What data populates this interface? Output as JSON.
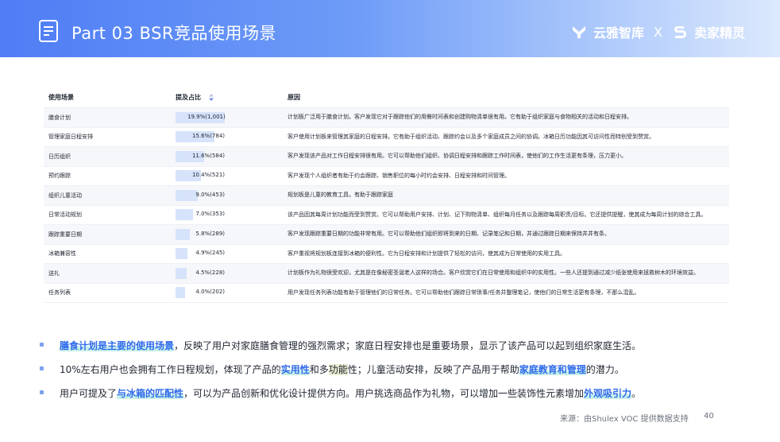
{
  "header": {
    "title": "Part 03  BSR竞品使用场景",
    "brand_left": "云雅智库",
    "brand_x": "X",
    "brand_right": "卖家精灵"
  },
  "table": {
    "columns": [
      "使用场景",
      "提及占比",
      "原因"
    ],
    "rows": [
      {
        "scene": "膳食计划",
        "share": 0.199,
        "pct": "19.9%(1,001)",
        "reason": "计划板广泛用于膳食计划。客户发现它对于跟踪他们的用餐时间表和创建购物清单很有用。它有助于组织家庭与食物相关的活动和日程安排。"
      },
      {
        "scene": "管理家庭日程安排",
        "share": 0.156,
        "pct": "15.6%(784)",
        "reason": "客户使用计划板来管理其家庭的日程安排。它有助于组织活动、跟踪约会以及多个家庭成员之间的协调。冰箱日历功能因其可访问性而特别受到赞赏。"
      },
      {
        "scene": "日历组织",
        "share": 0.116,
        "pct": "11.6%(584)",
        "reason": "客户发现该产品对工作日程安排很有用。它可以帮助他们组织、协调日程安排和跟踪工作时间表，使他们的工作生活更有条理，压力更小。"
      },
      {
        "scene": "预约跟踪",
        "share": 0.104,
        "pct": "10.4%(521)",
        "reason": "客户发现个人组织者有助于约会跟踪、销售职位的每小时约会安排、日程安排和时间管理。"
      },
      {
        "scene": "组织儿童活动",
        "share": 0.09,
        "pct": "9.0%(453)",
        "reason": "规划板是儿童的教育工具，有助于跟踪家庭"
      },
      {
        "scene": "日常活动规划",
        "share": 0.07,
        "pct": "7.0%(353)",
        "reason": "该产品因其每周计划功能而受到赞赏。它可以帮助用户安排、计划、记下购物清单、组织每月任务以及跟踪每周职责/目标。它还提供提醒，使其成为每周计划的综合工具。"
      },
      {
        "scene": "跟踪重要日期",
        "share": 0.058,
        "pct": "5.8%(289)",
        "reason": "客户发现跟踪重要日期的功能非常有用。它可以帮助他们组织即将到来的日期、记录笔记和日期，并通过跟踪日期来保持井井有条。"
      },
      {
        "scene": "冰箱兼容性",
        "share": 0.049,
        "pct": "4.9%(245)",
        "reason": "客户重视将规划板连接到冰箱的便利性。它为日程安排和计划提供了轻松的访问，使其成为日常使用的实用工具。"
      },
      {
        "scene": "送礼",
        "share": 0.045,
        "pct": "4.5%(228)",
        "reason": "计划板作为礼物很受欢迎，尤其是在像秘密圣诞老人这样的场合。客户欣赏它们在日常使用和组织中的实用性。一些人还提到通过减少纸张使用来拯救树木的环境效益。"
      },
      {
        "scene": "任务列表",
        "share": 0.04,
        "pct": "4.0%(202)",
        "reason": "用户发现任务列表功能有助于管理他们的日常任务。它可以帮助他们跟踪日常琐事/任务并整理笔记，使他们的日常生活更有条理，不那么混乱。"
      }
    ]
  },
  "bullets": {
    "b1": {
      "hl": "膳食计划是主要的使用场景",
      "rest": "，反映了用户对家庭膳食管理的强烈需求；家庭日程安排也是重要场景，显示了该产品可以起到组织家庭生活。"
    },
    "b2": {
      "p1": "10%左右用户也会拥有工作日程规划，体现了产品的",
      "hl1": "实用性",
      "p2": "和多",
      "hl2": "功能",
      "p3": "性；儿童活动安排，反映了产品用于帮助",
      "hl3": "家庭教育和管理",
      "p4": "的潜力。"
    },
    "b3": {
      "p1": "用户可提及了",
      "hl1": "与冰箱的匹配性",
      "p2": "，可以为产品创新和优化设计提供方向。用户挑选商品作为礼物，可以增加一些装饰性元素增加",
      "hl2": "外观吸引力",
      "p3": "。"
    }
  },
  "footer": {
    "source": "来源：由Shulex VOC 提供数据支持",
    "page": "40"
  },
  "colors": {
    "header_start": "#4f7df5",
    "accent": "#2f6bea",
    "bar": "#d6e3fb"
  }
}
